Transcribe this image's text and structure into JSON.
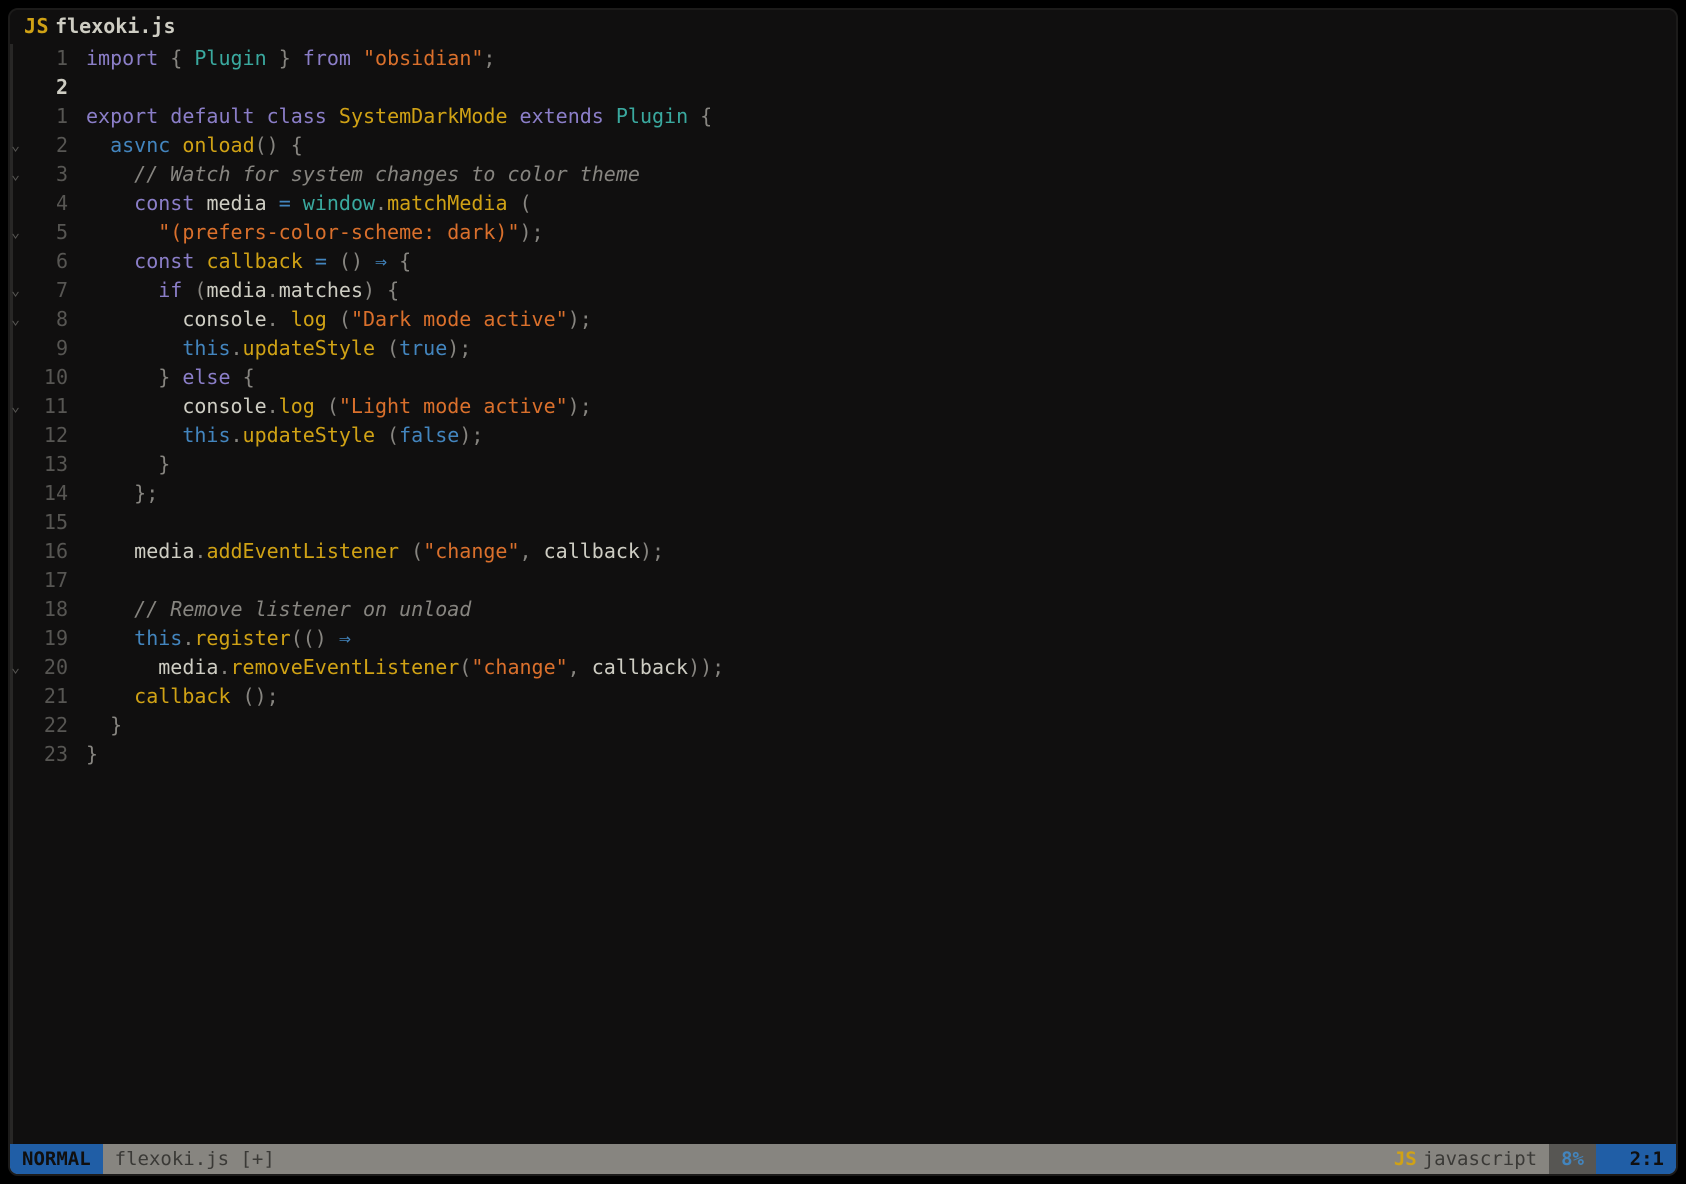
{
  "tab": {
    "icon_label": "JS",
    "filename": "flexoki.js"
  },
  "gutter": {
    "current_index": 1,
    "lines": [
      {
        "num": "1",
        "fold": false
      },
      {
        "num": "2",
        "fold": false,
        "current": true
      },
      {
        "num": "1",
        "fold": false
      },
      {
        "num": "2",
        "fold": true
      },
      {
        "num": "3",
        "fold": true
      },
      {
        "num": "4",
        "fold": false
      },
      {
        "num": "5",
        "fold": true
      },
      {
        "num": "6",
        "fold": false
      },
      {
        "num": "7",
        "fold": true
      },
      {
        "num": "8",
        "fold": true
      },
      {
        "num": "9",
        "fold": false
      },
      {
        "num": "10",
        "fold": false
      },
      {
        "num": "11",
        "fold": true
      },
      {
        "num": "12",
        "fold": false
      },
      {
        "num": "13",
        "fold": false
      },
      {
        "num": "14",
        "fold": false
      },
      {
        "num": "15",
        "fold": false
      },
      {
        "num": "16",
        "fold": false
      },
      {
        "num": "17",
        "fold": false
      },
      {
        "num": "18",
        "fold": false
      },
      {
        "num": "19",
        "fold": false
      },
      {
        "num": "20",
        "fold": true
      },
      {
        "num": "21",
        "fold": false
      },
      {
        "num": "22",
        "fold": false
      },
      {
        "num": "23",
        "fold": false
      }
    ]
  },
  "code": [
    [
      [
        "c-purple",
        "import"
      ],
      [
        "c-text",
        " "
      ],
      [
        "c-paren",
        "{"
      ],
      [
        "c-text",
        " "
      ],
      [
        "c-cyan",
        "Plugin"
      ],
      [
        "c-text",
        " "
      ],
      [
        "c-paren",
        "}"
      ],
      [
        "c-text",
        " "
      ],
      [
        "c-purple",
        "from"
      ],
      [
        "c-text",
        " "
      ],
      [
        "c-orange",
        "\"obsidian\""
      ],
      [
        "c-paren",
        ";"
      ]
    ],
    [],
    [
      [
        "c-purple",
        "export"
      ],
      [
        "c-text",
        " "
      ],
      [
        "c-purple",
        "default"
      ],
      [
        "c-text",
        " "
      ],
      [
        "c-purple",
        "class"
      ],
      [
        "c-text",
        " "
      ],
      [
        "c-yellow",
        "SystemDarkMode"
      ],
      [
        "c-text",
        " "
      ],
      [
        "c-purple",
        "extends"
      ],
      [
        "c-text",
        " "
      ],
      [
        "c-cyan",
        "Plugin"
      ],
      [
        "c-text",
        " "
      ],
      [
        "c-paren",
        "{"
      ]
    ],
    [
      [
        "c-text",
        "  "
      ],
      [
        "c-blue",
        "asvnc"
      ],
      [
        "c-text",
        " "
      ],
      [
        "c-yellow",
        "onload"
      ],
      [
        "c-paren",
        "()"
      ],
      [
        "c-text",
        " "
      ],
      [
        "c-paren",
        "{"
      ]
    ],
    [
      [
        "c-text",
        "    "
      ],
      [
        "c-comment",
        "// Watch for system changes to color theme"
      ]
    ],
    [
      [
        "c-text",
        "    "
      ],
      [
        "c-purple",
        "const"
      ],
      [
        "c-text",
        " "
      ],
      [
        "c-text",
        "media"
      ],
      [
        "c-text",
        " "
      ],
      [
        "c-blue",
        "="
      ],
      [
        "c-text",
        " "
      ],
      [
        "c-cyan",
        "window"
      ],
      [
        "c-paren",
        "."
      ],
      [
        "c-yellow",
        "matchMedia"
      ],
      [
        "c-text",
        " "
      ],
      [
        "c-paren",
        "("
      ]
    ],
    [
      [
        "c-text",
        "      "
      ],
      [
        "c-orange",
        "\"(prefers-color-scheme: dark)\""
      ],
      [
        "c-paren",
        ");"
      ]
    ],
    [
      [
        "c-text",
        "    "
      ],
      [
        "c-purple",
        "const"
      ],
      [
        "c-text",
        " "
      ],
      [
        "c-yellow",
        "callback"
      ],
      [
        "c-text",
        " "
      ],
      [
        "c-blue",
        "="
      ],
      [
        "c-text",
        " "
      ],
      [
        "c-paren",
        "()"
      ],
      [
        "c-text",
        " "
      ],
      [
        "c-blue",
        "⇒"
      ],
      [
        "c-text",
        " "
      ],
      [
        "c-paren",
        "{"
      ]
    ],
    [
      [
        "c-text",
        "      "
      ],
      [
        "c-purple",
        "if"
      ],
      [
        "c-text",
        " "
      ],
      [
        "c-paren",
        "("
      ],
      [
        "c-text",
        "media"
      ],
      [
        "c-paren",
        "."
      ],
      [
        "c-text",
        "matches"
      ],
      [
        "c-paren",
        ")"
      ],
      [
        "c-text",
        " "
      ],
      [
        "c-paren",
        "{"
      ]
    ],
    [
      [
        "c-text",
        "        "
      ],
      [
        "c-text",
        "console"
      ],
      [
        "c-paren",
        "."
      ],
      [
        "c-text",
        " "
      ],
      [
        "c-yellow",
        "log"
      ],
      [
        "c-text",
        " "
      ],
      [
        "c-paren",
        "("
      ],
      [
        "c-orange",
        "\"Dark mode active\""
      ],
      [
        "c-paren",
        ");"
      ]
    ],
    [
      [
        "c-text",
        "        "
      ],
      [
        "c-blue",
        "this"
      ],
      [
        "c-paren",
        "."
      ],
      [
        "c-yellow",
        "updateStyle"
      ],
      [
        "c-text",
        " "
      ],
      [
        "c-paren",
        "("
      ],
      [
        "c-blue",
        "true"
      ],
      [
        "c-paren",
        ");"
      ]
    ],
    [
      [
        "c-text",
        "      "
      ],
      [
        "c-paren",
        "}"
      ],
      [
        "c-text",
        " "
      ],
      [
        "c-purple",
        "else"
      ],
      [
        "c-text",
        " "
      ],
      [
        "c-paren",
        "{"
      ]
    ],
    [
      [
        "c-text",
        "        "
      ],
      [
        "c-text",
        "console"
      ],
      [
        "c-paren",
        "."
      ],
      [
        "c-yellow",
        "log"
      ],
      [
        "c-text",
        " "
      ],
      [
        "c-paren",
        "("
      ],
      [
        "c-orange",
        "\"Light mode active\""
      ],
      [
        "c-paren",
        ");"
      ]
    ],
    [
      [
        "c-text",
        "        "
      ],
      [
        "c-blue",
        "this"
      ],
      [
        "c-paren",
        "."
      ],
      [
        "c-yellow",
        "updateStyle"
      ],
      [
        "c-text",
        " "
      ],
      [
        "c-paren",
        "("
      ],
      [
        "c-blue",
        "false"
      ],
      [
        "c-paren",
        ");"
      ]
    ],
    [
      [
        "c-text",
        "      "
      ],
      [
        "c-paren",
        "}"
      ]
    ],
    [
      [
        "c-text",
        "    "
      ],
      [
        "c-paren",
        "};"
      ]
    ],
    [],
    [
      [
        "c-text",
        "    "
      ],
      [
        "c-text",
        "media"
      ],
      [
        "c-paren",
        "."
      ],
      [
        "c-yellow",
        "addEventListener"
      ],
      [
        "c-text",
        " "
      ],
      [
        "c-paren",
        "("
      ],
      [
        "c-orange",
        "\"change\""
      ],
      [
        "c-paren",
        ","
      ],
      [
        "c-text",
        " "
      ],
      [
        "c-text",
        "callback"
      ],
      [
        "c-paren",
        ");"
      ]
    ],
    [],
    [
      [
        "c-text",
        "    "
      ],
      [
        "c-comment",
        "// Remove listener on unload"
      ]
    ],
    [
      [
        "c-text",
        "    "
      ],
      [
        "c-blue",
        "this"
      ],
      [
        "c-paren",
        "."
      ],
      [
        "c-yellow",
        "register"
      ],
      [
        "c-paren",
        "(()"
      ],
      [
        "c-text",
        " "
      ],
      [
        "c-blue",
        "⇒"
      ]
    ],
    [
      [
        "c-text",
        "      "
      ],
      [
        "c-text",
        "media"
      ],
      [
        "c-paren",
        "."
      ],
      [
        "c-yellow",
        "removeEventListener"
      ],
      [
        "c-paren",
        "("
      ],
      [
        "c-orange",
        "\"change\""
      ],
      [
        "c-paren",
        ","
      ],
      [
        "c-text",
        " "
      ],
      [
        "c-text",
        "callback"
      ],
      [
        "c-paren",
        "));"
      ]
    ],
    [
      [
        "c-text",
        "    "
      ],
      [
        "c-yellow",
        "callback"
      ],
      [
        "c-text",
        " "
      ],
      [
        "c-paren",
        "();"
      ]
    ],
    [
      [
        "c-text",
        "  "
      ],
      [
        "c-paren",
        "}"
      ]
    ],
    [
      [
        "c-paren",
        "}"
      ]
    ]
  ],
  "statusbar": {
    "mode": "NORMAL",
    "file": "flexoki.js [+]",
    "lang_icon": "JS",
    "lang": "javascript",
    "percent": "8%",
    "position": "2:1"
  }
}
